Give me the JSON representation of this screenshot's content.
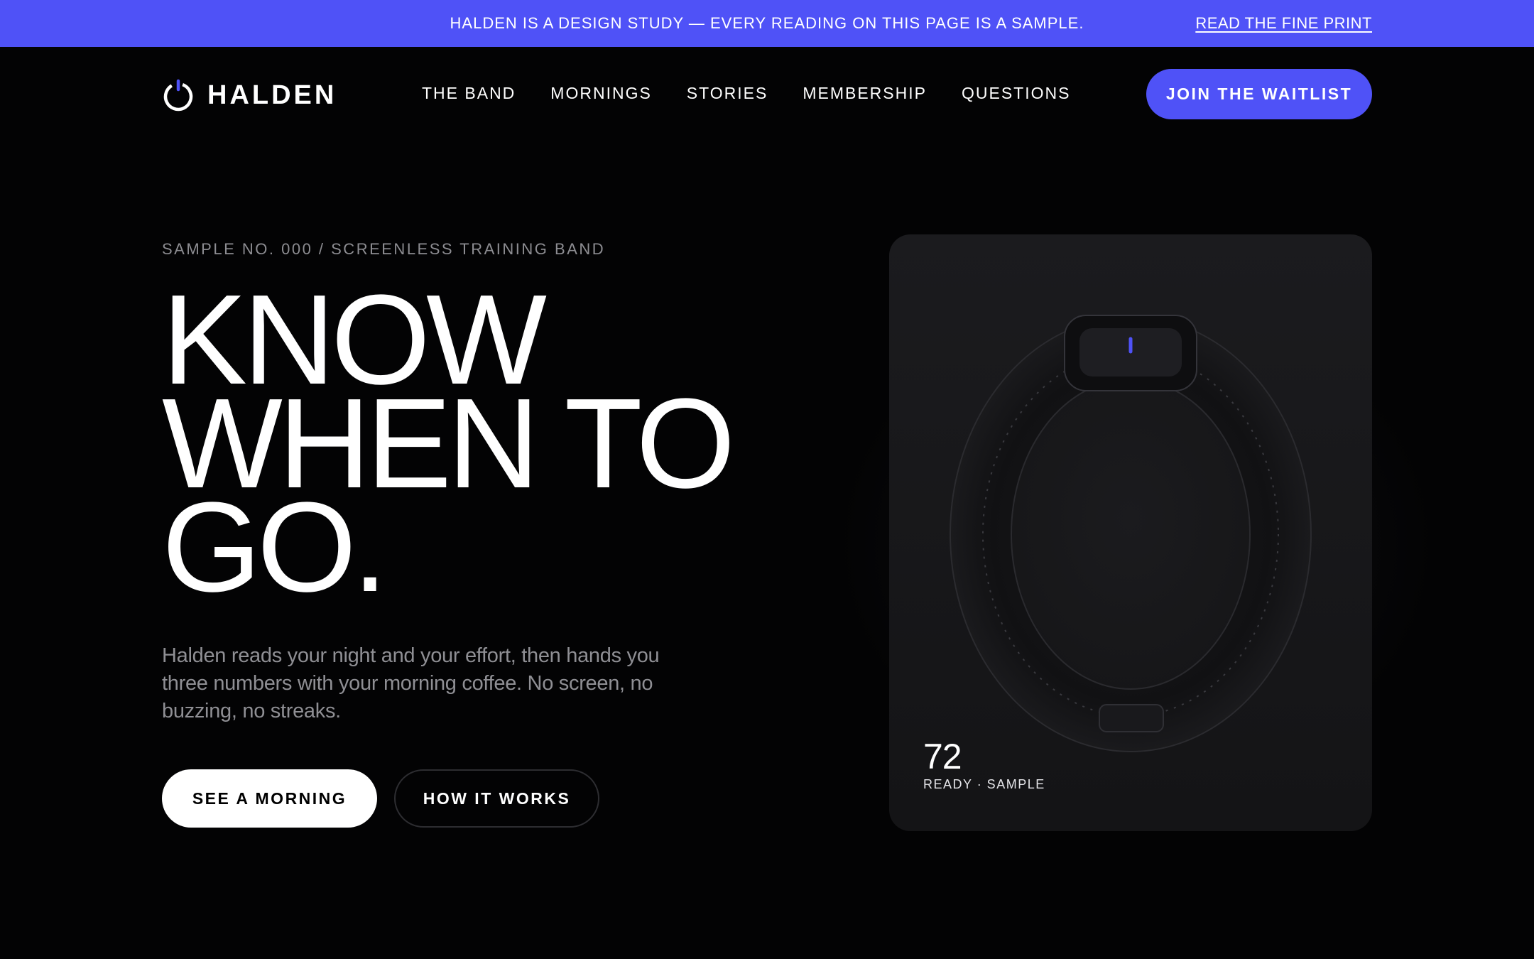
{
  "announcement": {
    "text": "HALDEN IS A DESIGN STUDY — EVERY READING ON THIS PAGE IS A SAMPLE.",
    "link_label": "READ THE FINE PRINT"
  },
  "brand": {
    "name": "HALDEN",
    "logo_icon": "power-ring-icon",
    "accent_color": "#4f52f7"
  },
  "nav": {
    "items": [
      {
        "label": "THE BAND"
      },
      {
        "label": "MORNINGS"
      },
      {
        "label": "STORIES"
      },
      {
        "label": "MEMBERSHIP"
      },
      {
        "label": "QUESTIONS"
      }
    ],
    "cta_label": "JOIN THE WAITLIST"
  },
  "hero": {
    "eyebrow": "SAMPLE NO. 000 / SCREENLESS TRAINING BAND",
    "headline_lines": [
      "KNOW",
      "WHEN TO",
      "GO."
    ],
    "lede": "Halden reads your night and your effort, then hands you three numbers with your morning coffee. No screen, no buzzing, no streaks.",
    "primary_button": "SEE A MORNING",
    "secondary_button": "HOW IT WORKS"
  },
  "device_card": {
    "reading_value": "72",
    "reading_label": "READY · SAMPLE",
    "indicator_color": "#4f52f7"
  }
}
